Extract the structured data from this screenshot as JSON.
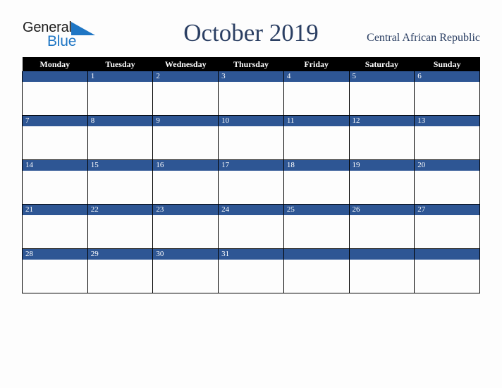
{
  "brand": {
    "name_line1": "General",
    "name_line2": "Blue",
    "triangle_color": "#1f76c4",
    "text_color": "#1b1b1b"
  },
  "header": {
    "title": "October 2019",
    "country": "Central African Republic",
    "title_color": "#2b3f63"
  },
  "calendar": {
    "month": "October",
    "year": "2019",
    "week_start": "Monday",
    "header_bg": "#000000",
    "header_text_color": "#ffffff",
    "daynum_bg": "#2e5694",
    "daynum_text_color": "#ffffff",
    "cell_bg": "#fdfdfd",
    "grid_color": "#000000",
    "weekdays": [
      "Monday",
      "Tuesday",
      "Wednesday",
      "Thursday",
      "Friday",
      "Saturday",
      "Sunday"
    ],
    "weeks": [
      [
        {
          "day": ""
        },
        {
          "day": "1"
        },
        {
          "day": "2"
        },
        {
          "day": "3"
        },
        {
          "day": "4"
        },
        {
          "day": "5"
        },
        {
          "day": "6"
        }
      ],
      [
        {
          "day": "7"
        },
        {
          "day": "8"
        },
        {
          "day": "9"
        },
        {
          "day": "10"
        },
        {
          "day": "11"
        },
        {
          "day": "12"
        },
        {
          "day": "13"
        }
      ],
      [
        {
          "day": "14"
        },
        {
          "day": "15"
        },
        {
          "day": "16"
        },
        {
          "day": "17"
        },
        {
          "day": "18"
        },
        {
          "day": "19"
        },
        {
          "day": "20"
        }
      ],
      [
        {
          "day": "21"
        },
        {
          "day": "22"
        },
        {
          "day": "23"
        },
        {
          "day": "24"
        },
        {
          "day": "25"
        },
        {
          "day": "26"
        },
        {
          "day": "27"
        }
      ],
      [
        {
          "day": "28"
        },
        {
          "day": "29"
        },
        {
          "day": "30"
        },
        {
          "day": "31"
        },
        {
          "day": ""
        },
        {
          "day": ""
        },
        {
          "day": ""
        }
      ]
    ]
  }
}
